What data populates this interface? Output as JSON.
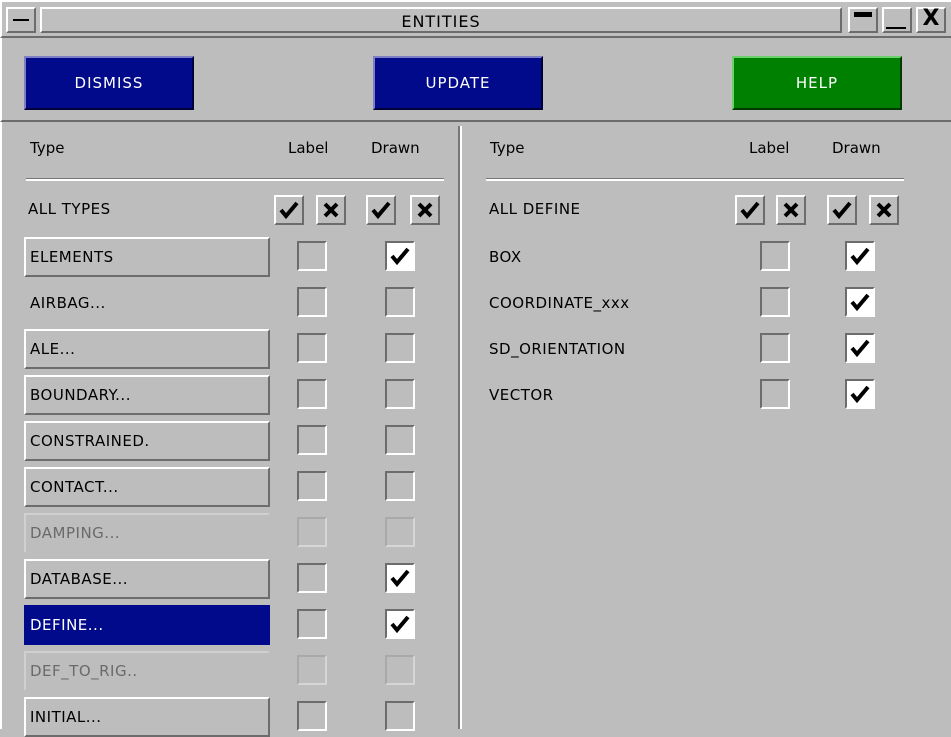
{
  "window": {
    "title": "ENTITIES",
    "menu_icon": "window-menu-icon",
    "minimize_icon": "minimize-icon",
    "maximize_icon": "maximize-icon",
    "close_label": "X"
  },
  "actions": {
    "dismiss": "DISMISS",
    "update": "UPDATE",
    "help": "HELP",
    "colors": {
      "blue": "#000a8a",
      "green": "#008000"
    }
  },
  "left": {
    "headers": {
      "type": "Type",
      "label": "Label",
      "drawn": "Drawn"
    },
    "all_row": "ALL TYPES",
    "rows": [
      {
        "name": "ELEMENTS",
        "label_checked": false,
        "drawn_checked": true,
        "style": "button"
      },
      {
        "name": "AIRBAG...",
        "label_checked": false,
        "drawn_checked": false,
        "style": "flat"
      },
      {
        "name": "ALE...",
        "label_checked": false,
        "drawn_checked": false,
        "style": "button"
      },
      {
        "name": "BOUNDARY...",
        "label_checked": false,
        "drawn_checked": false,
        "style": "button"
      },
      {
        "name": "CONSTRAINED.",
        "label_checked": false,
        "drawn_checked": false,
        "style": "button"
      },
      {
        "name": "CONTACT...",
        "label_checked": false,
        "drawn_checked": false,
        "style": "button"
      },
      {
        "name": "DAMPING...",
        "label_checked": false,
        "drawn_checked": false,
        "style": "disabled"
      },
      {
        "name": "DATABASE...",
        "label_checked": false,
        "drawn_checked": true,
        "style": "button"
      },
      {
        "name": "DEFINE...",
        "label_checked": false,
        "drawn_checked": true,
        "style": "selected"
      },
      {
        "name": "DEF_TO_RIG..",
        "label_checked": false,
        "drawn_checked": false,
        "style": "disabled"
      },
      {
        "name": "INITIAL...",
        "label_checked": false,
        "drawn_checked": false,
        "style": "button"
      }
    ]
  },
  "right": {
    "headers": {
      "type": "Type",
      "label": "Label",
      "drawn": "Drawn"
    },
    "all_row": "ALL DEFINE",
    "rows": [
      {
        "name": "BOX",
        "label_checked": false,
        "drawn_checked": true
      },
      {
        "name": "COORDINATE_xxx",
        "label_checked": false,
        "drawn_checked": true
      },
      {
        "name": "SD_ORIENTATION",
        "label_checked": false,
        "drawn_checked": true
      },
      {
        "name": "VECTOR",
        "label_checked": false,
        "drawn_checked": true
      }
    ]
  }
}
